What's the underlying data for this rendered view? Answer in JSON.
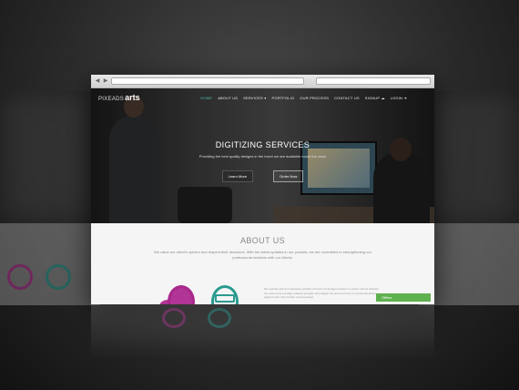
{
  "site": {
    "logo_prefix": "PIXEADS",
    "logo_main": "arts"
  },
  "browser": {
    "back_icon": "◀",
    "forward_icon": "▶"
  },
  "nav": {
    "items": [
      {
        "label": "HOME",
        "active": true
      },
      {
        "label": "ABOUT US",
        "active": false
      },
      {
        "label": "SERVICES ▾",
        "active": false
      },
      {
        "label": "PORTFOLIO",
        "active": false
      },
      {
        "label": "OUR PROCESS",
        "active": false
      },
      {
        "label": "CONTACT US",
        "active": false
      },
      {
        "label": "SIGNUP ☁",
        "active": false
      },
      {
        "label": "LOGIN ➜",
        "active": false
      }
    ]
  },
  "hero": {
    "title": "DIGITIZING SERVICES",
    "subtitle": "Providing the best quality designs in the town! we are available round the clock",
    "learn_more": "Learn More",
    "order_now": "Order Now"
  },
  "about": {
    "title": "ABOUT US",
    "intro": "We value our client's opinion and respect their decisions. With the latest updates in our pockets, we are committed to strengthening our professional relations with our clients.",
    "paragraph": "We operate with an impressive portfolio of iconic art designs located in London and its suburbs. Our team runs a design analysis program and weighs the pros and cons of a potential design against each other before moving ahead."
  },
  "chat": {
    "status": "Offline"
  },
  "colors": {
    "accent": "#49c2a9",
    "teal": "#2a9a8f",
    "purple": "#b03595",
    "offline": "#5fb04f"
  }
}
